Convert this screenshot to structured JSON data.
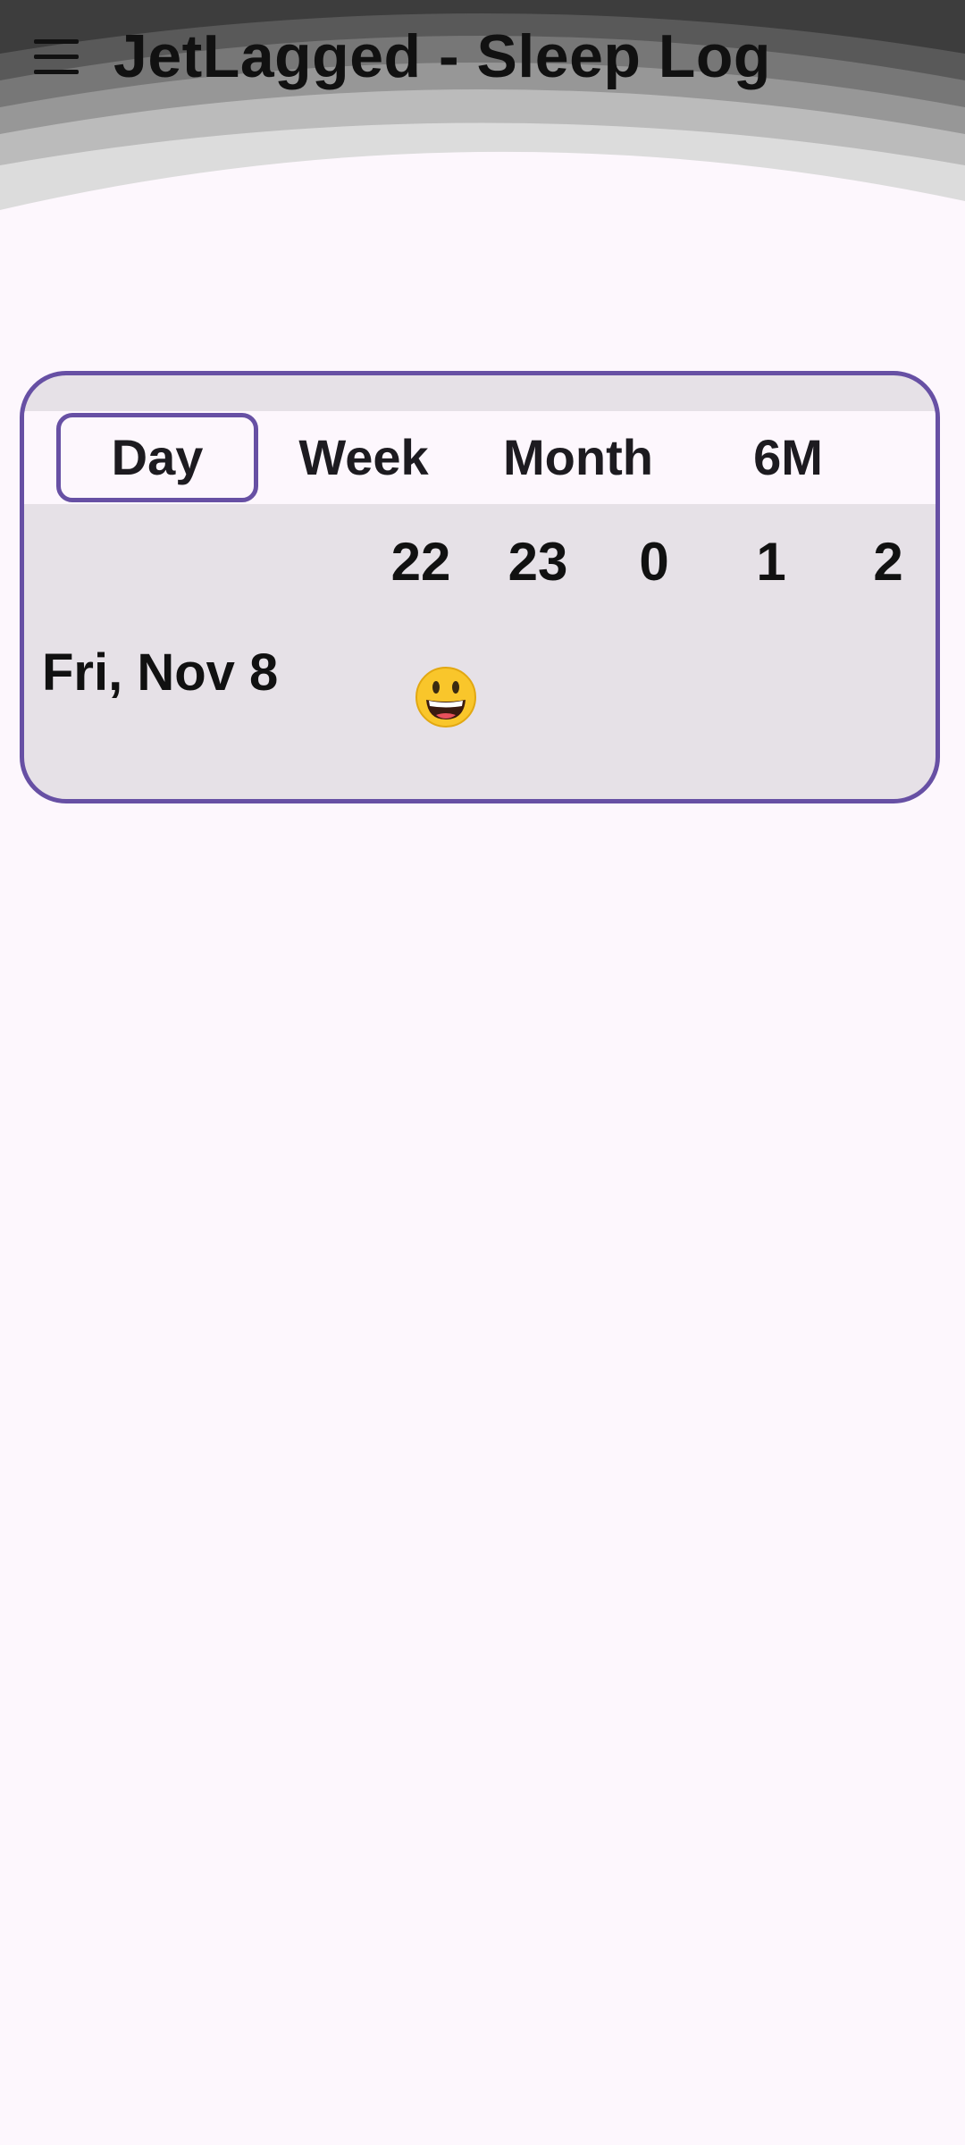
{
  "app": {
    "title": "JetLagged - Sleep Log"
  },
  "header": {
    "menu_icon": "hamburger-menu-icon",
    "band_colors": [
      "#222222",
      "#3D3D3D",
      "#595959",
      "#777777",
      "#979797",
      "#BBBBBB",
      "#DCDCDC"
    ]
  },
  "colors": {
    "accent": "#6750A4",
    "background": "#FDF7FD",
    "card": "#E6E1E7"
  },
  "tabs": [
    {
      "label": "Day",
      "selected": true
    },
    {
      "label": "Week",
      "selected": false
    },
    {
      "label": "Month",
      "selected": false
    },
    {
      "label": "6M",
      "selected": false
    }
  ],
  "timeline": {
    "hours": [
      "22",
      "23",
      "0",
      "1",
      "2"
    ]
  },
  "entries": [
    {
      "date_label": "Fri, Nov 8",
      "mood_icon": "grinning-face-icon"
    }
  ]
}
